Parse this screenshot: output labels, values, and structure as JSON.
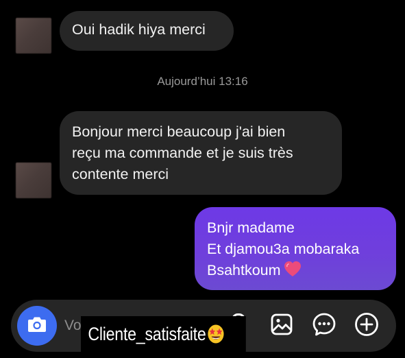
{
  "messages": [
    {
      "direction": "incoming",
      "lines": [
        "Oui hadik hiya merci"
      ]
    },
    {
      "direction": "incoming",
      "lines": [
        "Bonjour merci beaucoup j'ai bien",
        "reçu ma commande et je suis très",
        "contente merci"
      ]
    },
    {
      "direction": "outgoing",
      "lines": [
        "Bnjr madame",
        "Et djamou3a mobaraka",
        "Bsahtkoum"
      ],
      "trailing_icon": "heart-emoji"
    }
  ],
  "timestamp": "Aujourd’hui 13:16",
  "composer": {
    "placeholder": "Vo",
    "icons": [
      "camera-icon",
      "microphone-icon",
      "gallery-icon",
      "sticker-chat-icon",
      "add-icon"
    ]
  },
  "overlay": {
    "text": "Cliente_satisfaite",
    "emoji": "star-struck-emoji"
  },
  "colors": {
    "background": "#000000",
    "incoming_bubble": "#262626",
    "outgoing_bubble": "#6f3fdc",
    "camera_button": "#3d6cf0",
    "timestamp": "#9a9a9a"
  }
}
